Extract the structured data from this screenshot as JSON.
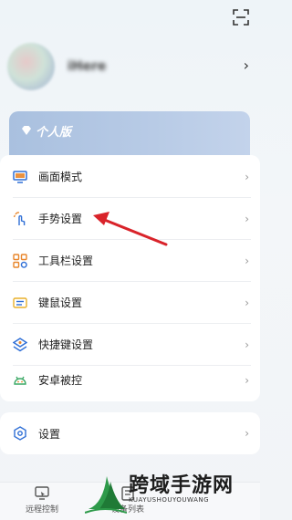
{
  "profile": {
    "username": "iHere"
  },
  "edition": {
    "label": "个人版"
  },
  "menu": {
    "items": [
      {
        "label": "画面模式",
        "icon": "monitor-icon"
      },
      {
        "label": "手势设置",
        "icon": "gesture-icon"
      },
      {
        "label": "工具栏设置",
        "icon": "toolbar-icon"
      },
      {
        "label": "键鼠设置",
        "icon": "keyboard-mouse-icon"
      },
      {
        "label": "快捷键设置",
        "icon": "shortcut-icon"
      },
      {
        "label": "安卓被控",
        "icon": "android-icon"
      }
    ]
  },
  "settings": {
    "label": "设置",
    "icon": "settings-icon"
  },
  "tabbar": {
    "tabs": [
      {
        "label": "远程控制",
        "icon": "remote-control-icon"
      },
      {
        "label": "设备列表",
        "icon": "device-list-icon"
      }
    ]
  },
  "watermark": {
    "title": "跨域手游网",
    "subtitle": "KUAYUSHOUYOUWANG"
  },
  "colors": {
    "accent_blue": "#2f6fd6",
    "accent_orange": "#e8862b",
    "annotation_red": "#d9232a"
  }
}
